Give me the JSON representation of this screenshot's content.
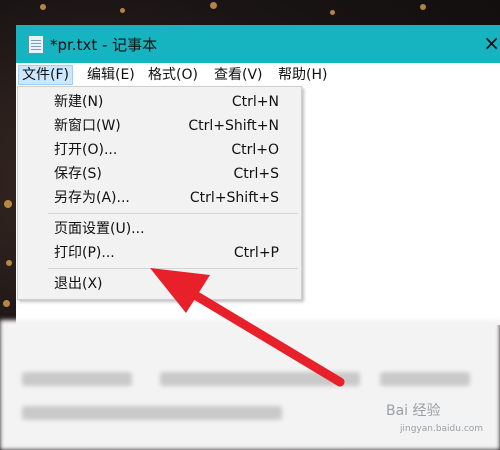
{
  "window": {
    "title": "*pr.txt - 记事本",
    "close_glyph": "×"
  },
  "menubar": {
    "items": [
      {
        "label": "文件(F)"
      },
      {
        "label": "编辑(E)"
      },
      {
        "label": "格式(O)"
      },
      {
        "label": "查看(V)"
      },
      {
        "label": "帮助(H)"
      }
    ]
  },
  "file_menu": {
    "items": [
      {
        "label": "新建(N)",
        "shortcut": "Ctrl+N"
      },
      {
        "label": "新窗口(W)",
        "shortcut": "Ctrl+Shift+N"
      },
      {
        "label": "打开(O)...",
        "shortcut": "Ctrl+O"
      },
      {
        "label": "保存(S)",
        "shortcut": "Ctrl+S"
      },
      {
        "label": "另存为(A)...",
        "shortcut": "Ctrl+Shift+S"
      },
      {
        "label": "页面设置(U)...",
        "shortcut": ""
      },
      {
        "label": "打印(P)...",
        "shortcut": "Ctrl+P"
      },
      {
        "label": "退出(X)",
        "shortcut": ""
      }
    ]
  },
  "watermark": {
    "main": "Bai 经验",
    "sub": "jingyan.baidu.com"
  },
  "colors": {
    "titlebar": "#16b3c0",
    "menu_highlight": "#cce8ff",
    "arrow": "#e8202a"
  }
}
